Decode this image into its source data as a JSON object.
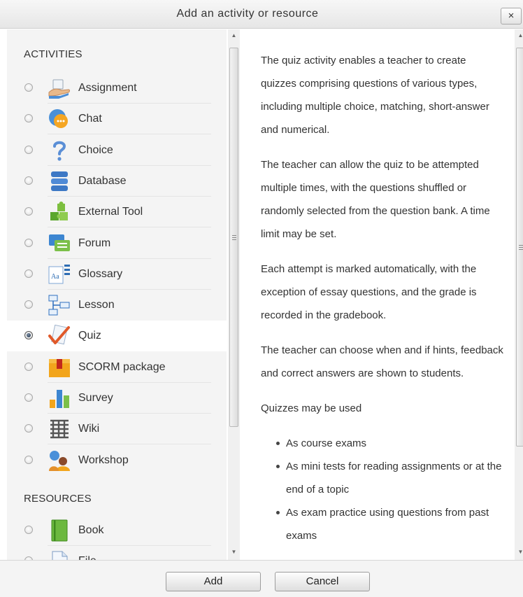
{
  "dialog": {
    "title": "Add an activity or resource",
    "close_symbol": "×"
  },
  "activities": {
    "heading": "ACTIVITIES",
    "items": [
      {
        "label": "Assignment",
        "icon": "assignment-icon",
        "selected": false
      },
      {
        "label": "Chat",
        "icon": "chat-icon",
        "selected": false
      },
      {
        "label": "Choice",
        "icon": "choice-icon",
        "selected": false
      },
      {
        "label": "Database",
        "icon": "database-icon",
        "selected": false
      },
      {
        "label": "External Tool",
        "icon": "external-tool-icon",
        "selected": false
      },
      {
        "label": "Forum",
        "icon": "forum-icon",
        "selected": false
      },
      {
        "label": "Glossary",
        "icon": "glossary-icon",
        "selected": false
      },
      {
        "label": "Lesson",
        "icon": "lesson-icon",
        "selected": false
      },
      {
        "label": "Quiz",
        "icon": "quiz-icon",
        "selected": true
      },
      {
        "label": "SCORM package",
        "icon": "scorm-package-icon",
        "selected": false
      },
      {
        "label": "Survey",
        "icon": "survey-icon",
        "selected": false
      },
      {
        "label": "Wiki",
        "icon": "wiki-icon",
        "selected": false
      },
      {
        "label": "Workshop",
        "icon": "workshop-icon",
        "selected": false
      }
    ]
  },
  "resources": {
    "heading": "RESOURCES",
    "items": [
      {
        "label": "Book",
        "icon": "book-icon",
        "selected": false
      },
      {
        "label": "File",
        "icon": "file-icon",
        "selected": false
      }
    ]
  },
  "description": {
    "paragraphs": [
      "The quiz activity enables a teacher to create quizzes comprising questions of various types, including multiple choice, matching, short-answer and numerical.",
      "The teacher can allow the quiz to be attempted multiple times, with the questions shuffled or randomly selected from the question bank. A time limit may be set.",
      "Each attempt is marked automatically, with the exception of essay questions, and the grade is recorded in the gradebook.",
      "The teacher can choose when and if hints, feedback and correct answers are shown to students.",
      "Quizzes may be used"
    ],
    "bullets": [
      "As course exams",
      "As mini tests for reading assignments or at the end of a topic",
      "As exam practice using questions from past exams"
    ]
  },
  "footer": {
    "add_label": "Add",
    "cancel_label": "Cancel"
  }
}
